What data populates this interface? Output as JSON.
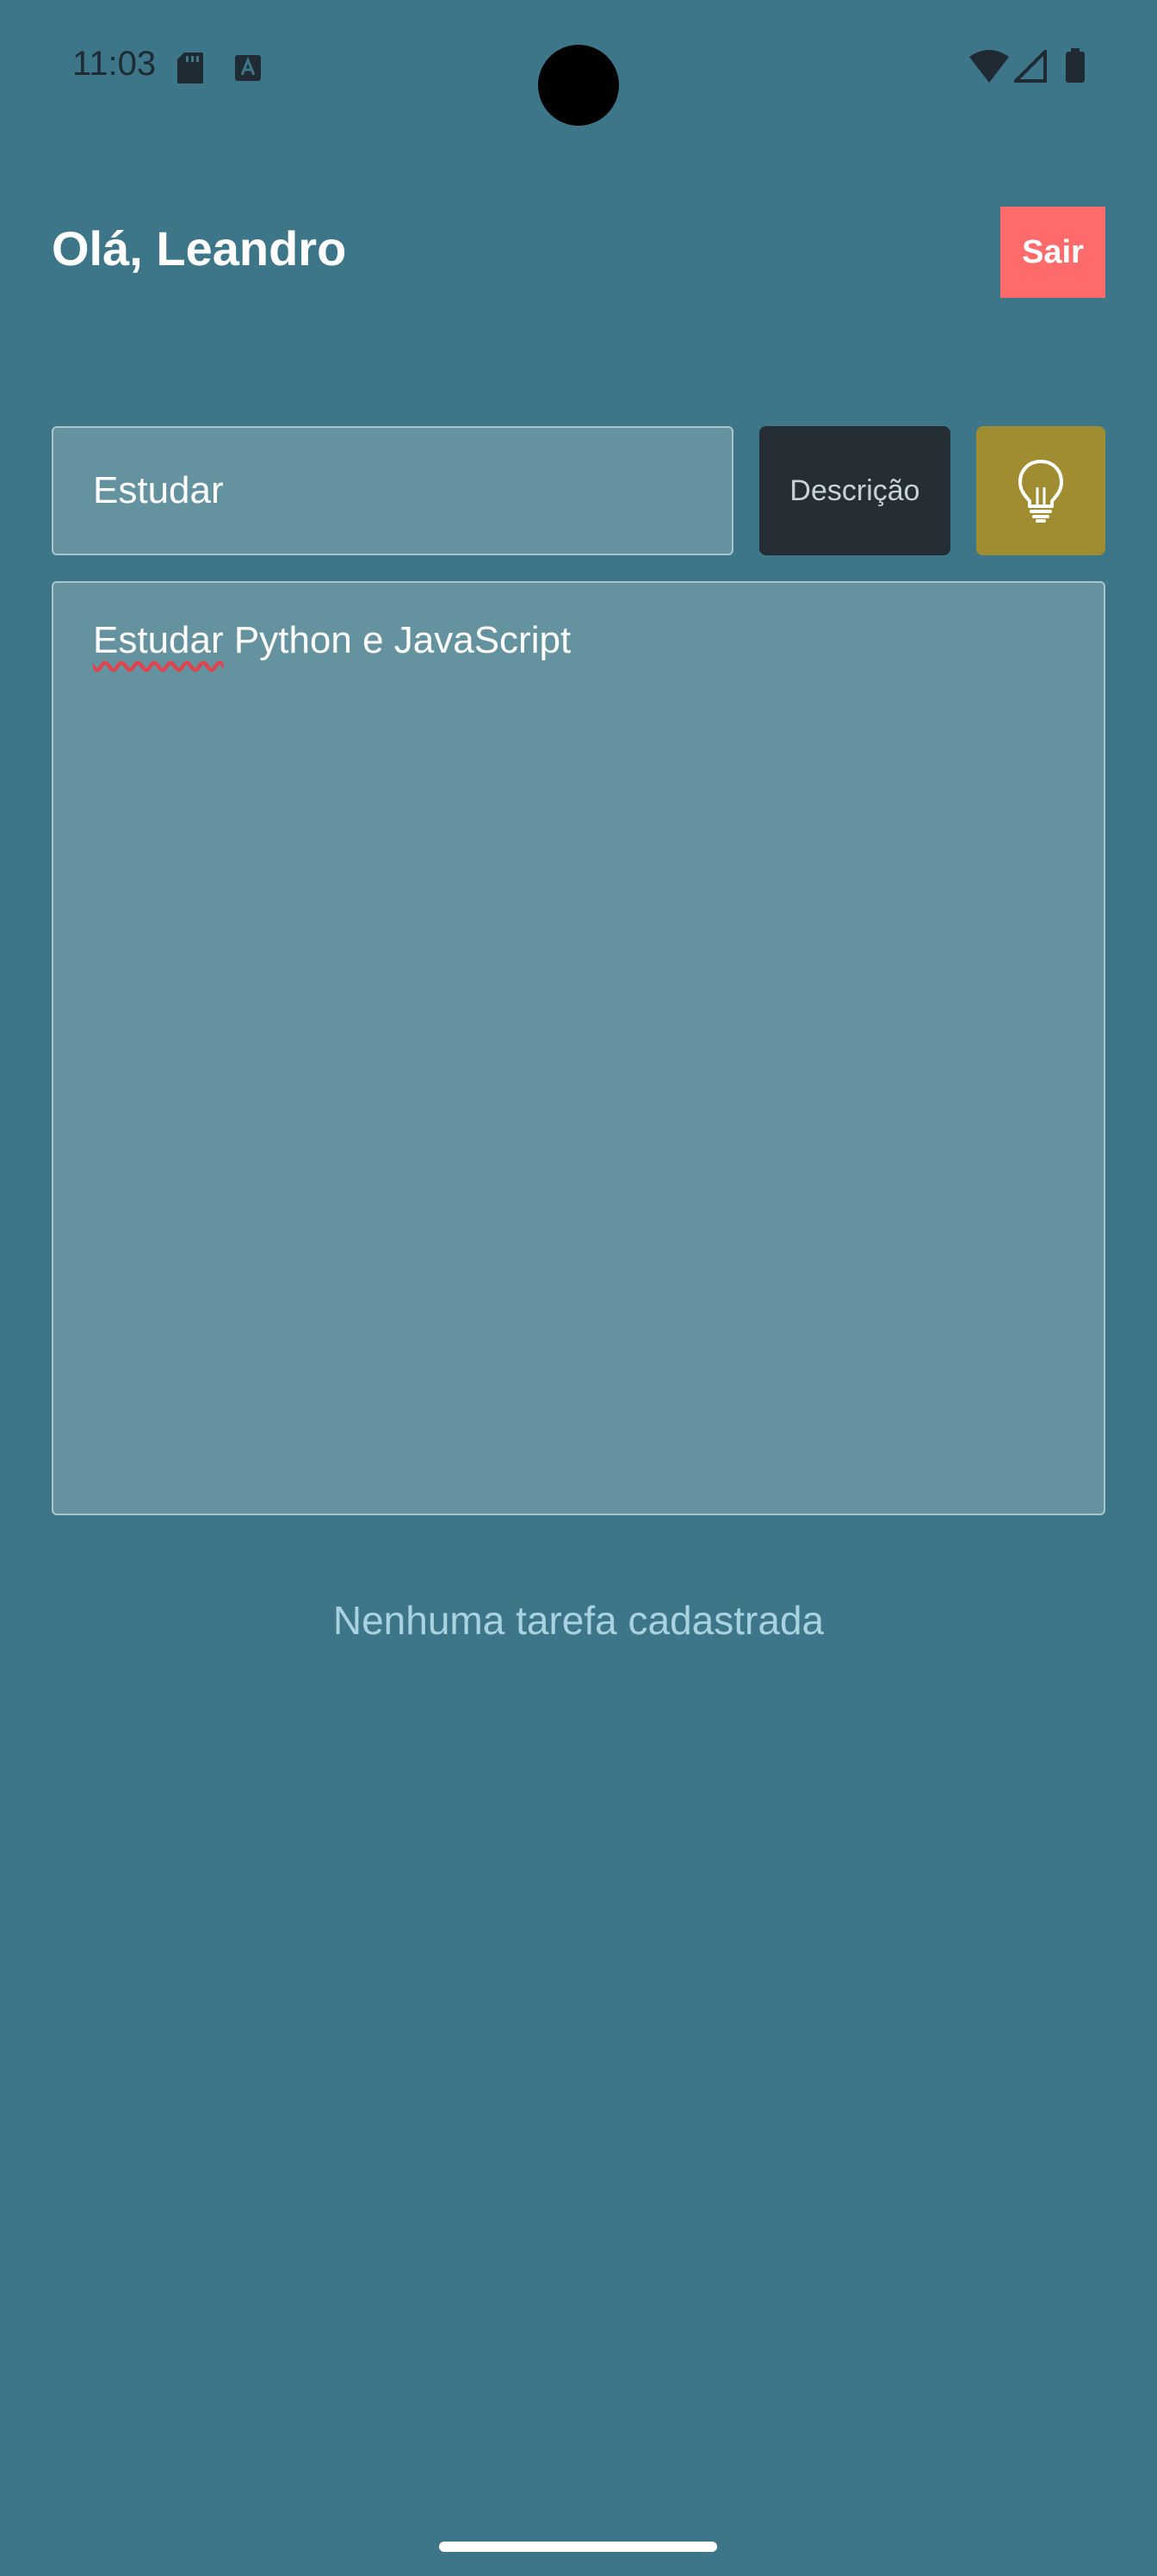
{
  "status_bar": {
    "time": "11:03",
    "icons": [
      "sd-card-icon",
      "text-a-icon",
      "wifi-icon",
      "cell-signal-icon",
      "battery-icon"
    ]
  },
  "header": {
    "greeting": "Olá, Leandro",
    "logout_label": "Sair"
  },
  "task_form": {
    "title_value": "Estudar",
    "description_toggle_label": "Descrição",
    "idea_button_icon": "lightbulb-icon",
    "description_misspelled_word": "Estudar",
    "description_rest": " Python e JavaScript"
  },
  "task_list": {
    "empty_message": "Nenhuma tarefa cadastrada"
  },
  "colors": {
    "background": "#3d7589",
    "input_background": "#64939f",
    "logout_button": "#ff6b6b",
    "description_button": "#252e35",
    "idea_button": "#a08d31",
    "empty_message_text": "#a9d3e0"
  }
}
